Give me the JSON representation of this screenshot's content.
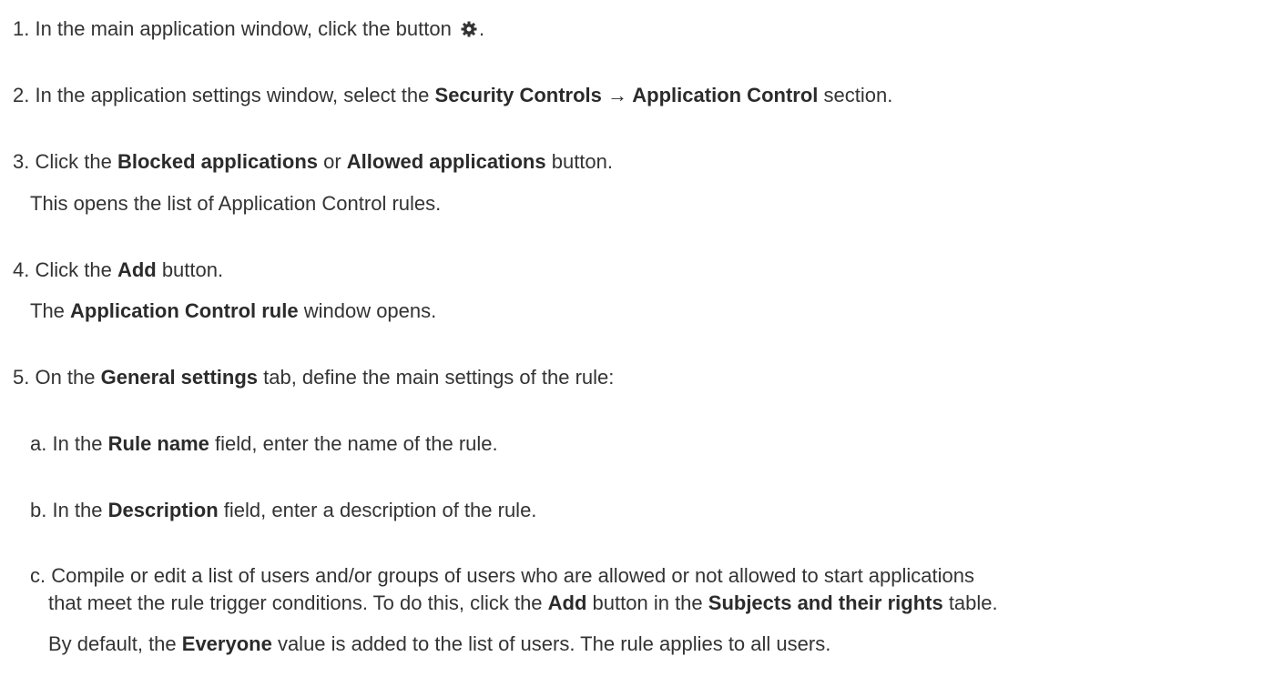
{
  "steps": {
    "s1": {
      "a": "1. In the main application window, click the button ",
      "icon": "gear-icon",
      "b": "."
    },
    "s2": {
      "a": "2. In the application settings window, select the ",
      "b1": "Security Controls → Application Control",
      "c": " section."
    },
    "s3": {
      "a": "3. Click the ",
      "b1": "Blocked applications",
      "c": " or ",
      "b2": "Allowed applications",
      "d": " button."
    },
    "s3_note": "This opens the list of Application Control rules.",
    "s4": {
      "a": "4. Click the ",
      "b1": "Add",
      "c": " button."
    },
    "s4_note": {
      "a": "The ",
      "b1": "Application Control rule",
      "c": " window opens."
    },
    "s5": {
      "a": "5. On the ",
      "b1": "General settings",
      "c": " tab, define the main settings of the rule:"
    },
    "sa": {
      "a": "a. In the ",
      "b1": "Rule name",
      "c": " field, enter the name of the rule."
    },
    "sb": {
      "a": "b. In the ",
      "b1": "Description",
      "c": " field, enter a description of the rule."
    },
    "sc_line1": "c. Compile or edit a list of users and/or groups of users who are allowed or not allowed to start applications",
    "sc_line2": {
      "a": "that meet the rule trigger conditions. To do this, click the ",
      "b1": "Add",
      "c": " button in the ",
      "b2": "Subjects and their rights",
      "d": " table."
    },
    "sc_note": {
      "a": "By default, the ",
      "b1": "Everyone",
      "c": " value is added to the list of users. The rule applies to all users."
    }
  }
}
